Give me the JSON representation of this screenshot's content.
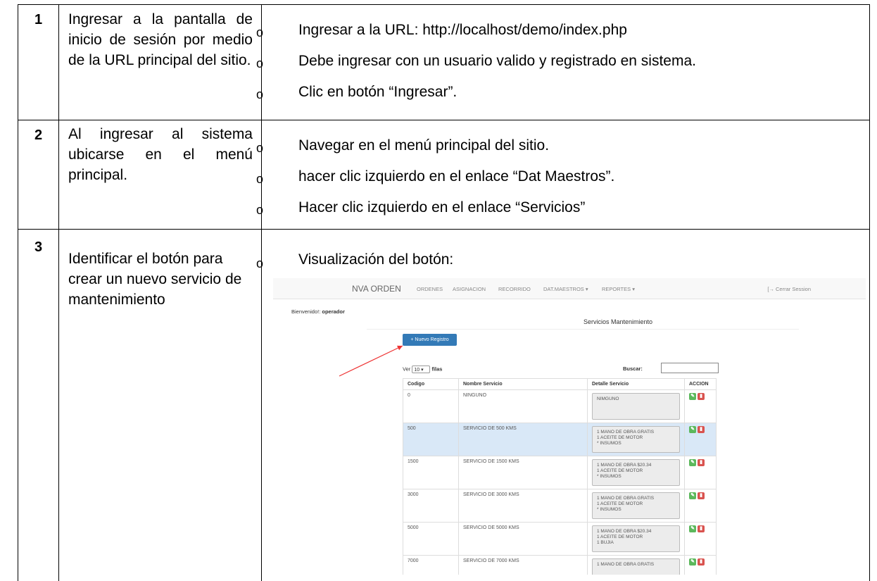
{
  "rows": [
    {
      "number": "1",
      "description": "Ingresar a la pantalla de inicio de sesión por medio de la URL principal del sitio.",
      "steps": [
        "Ingresar a la URL: http://localhost/demo/index.php",
        "Debe ingresar con un usuario valido y registrado en sistema.",
        "Clic en botón “Ingresar”."
      ]
    },
    {
      "number": "2",
      "description": "Al ingresar al sistema ubicarse en el menú principal.",
      "steps": [
        "Navegar en el menú principal del sitio.",
        "hacer clic izquierdo en el enlace “Dat Maestros”.",
        "Hacer clic izquierdo en el enlace “Servicios”"
      ]
    },
    {
      "number": "3",
      "description": "Identificar el botón para crear un nuevo servicio de mantenimiento",
      "steps": [
        "Visualización del botón:"
      ]
    }
  ],
  "bullet_mark": "o",
  "screenshot": {
    "brand": "NVA ORDEN",
    "nav": [
      "ORDENES",
      "ASIGNACION",
      "RECORRIDO",
      "DAT.MAESTROS ▾",
      "REPORTES ▾"
    ],
    "logout": "[→ Cerrar Session",
    "welcome_label": "Bienvenido!:",
    "welcome_user": "operador",
    "page_title": "Servicios Mantenimiento",
    "new_button": "+ Nuevo Registro",
    "length_prefix": "Ver",
    "length_value": "10",
    "length_suffix": "filas",
    "search_label": "Buscar:",
    "columns": [
      "Codigo",
      "Nombre Servicio",
      "Detalle Servicio",
      "ACCION"
    ],
    "rows": [
      {
        "code": "0",
        "name": "NINGUNO",
        "detail": "NIMGUNO"
      },
      {
        "code": "500",
        "name": "SERVICIO DE 500 KMS",
        "detail": "1 MANO DE OBRA GRATIS\n1 ACEITE DE MOTOR\n* INSUMOS"
      },
      {
        "code": "1500",
        "name": "SERVICIO DE 1500 KMS",
        "detail": "1 MANO DE OBRA $20.34\n1 ACEITE DE MOTOR\n* INSUMOS"
      },
      {
        "code": "3000",
        "name": "SERVICIO DE 3000 KMS",
        "detail": "1 MANO DE OBRA GRATIS\n1 ACEITE DE MOTOR\n* INSUMOS"
      },
      {
        "code": "5000",
        "name": "SERVICIO DE 5000 KMS",
        "detail": "1 MANO DE OBRA $20.34\n1 ACEITE DE MOTOR\n1 BUJIA"
      },
      {
        "code": "7000",
        "name": "SERVICIO DE 7000 KMS",
        "detail": "1 MANO DE OBRA GRATIS"
      }
    ]
  }
}
